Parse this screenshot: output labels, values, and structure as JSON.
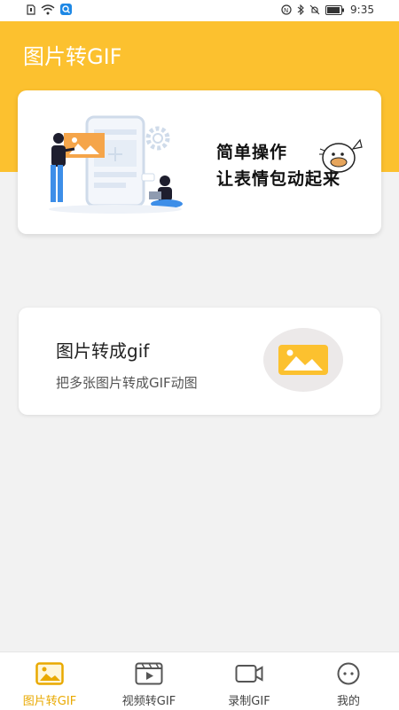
{
  "status_bar": {
    "time": "9:35"
  },
  "header": {
    "title": "图片转GIF"
  },
  "banner": {
    "line1": "简单操作",
    "line2": "让表情包动起来"
  },
  "feature_card": {
    "title": "图片转成gif",
    "description": "把多张图片转成GIF动图"
  },
  "tabs": [
    {
      "label": "图片转GIF",
      "icon": "image-icon",
      "active": true
    },
    {
      "label": "视频转GIF",
      "icon": "video-icon",
      "active": false
    },
    {
      "label": "录制GIF",
      "icon": "camera-icon",
      "active": false
    },
    {
      "label": "我的",
      "icon": "profile-icon",
      "active": false
    }
  ],
  "colors": {
    "accent": "#fcc12f",
    "active_tab": "#e9a900",
    "background": "#f2f2f2"
  }
}
